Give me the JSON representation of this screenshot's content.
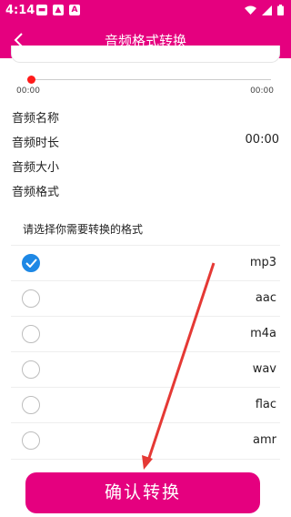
{
  "status_bar": {
    "time": "4:14",
    "left_icons": [
      "notification-icon",
      "image-icon",
      "app-icon"
    ],
    "right_icons": [
      "wifi-icon",
      "signal-icon",
      "battery-icon"
    ]
  },
  "app_bar": {
    "title": "音频格式转换",
    "back_icon": "chevron-left-icon"
  },
  "player": {
    "start_time": "00:00",
    "end_time": "00:00",
    "progress": 0
  },
  "info": [
    {
      "label": "音频名称",
      "value": ""
    },
    {
      "label": "音频时长",
      "value": "00:00"
    },
    {
      "label": "音频大小",
      "value": ""
    },
    {
      "label": "音频格式",
      "value": ""
    }
  ],
  "format_prompt": "请选择你需要转换的格式",
  "formats": [
    {
      "label": "mp3",
      "selected": true
    },
    {
      "label": "aac",
      "selected": false
    },
    {
      "label": "m4a",
      "selected": false
    },
    {
      "label": "wav",
      "selected": false
    },
    {
      "label": "flac",
      "selected": false
    },
    {
      "label": "amr",
      "selected": false
    }
  ],
  "confirm_label": "确认转换",
  "colors": {
    "brand": "#e5007f",
    "check": "#1e88e5",
    "arrow": "#e53935"
  }
}
